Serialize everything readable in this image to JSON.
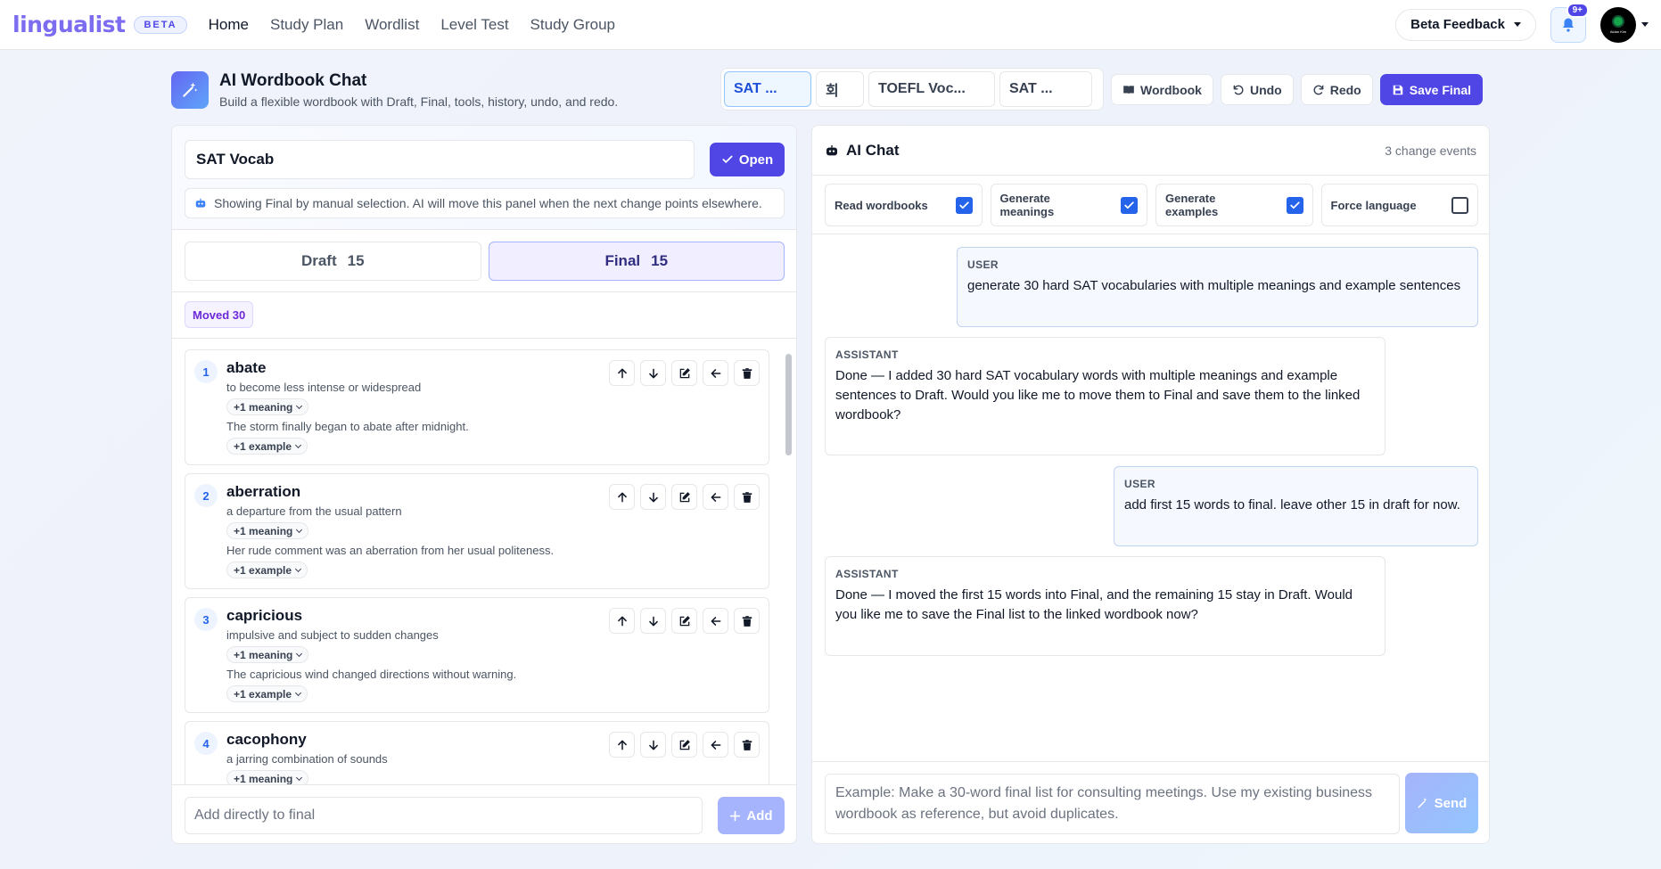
{
  "nav": {
    "logo": "lingualist",
    "beta": "BETA",
    "links": [
      "Home",
      "Study Plan",
      "Wordlist",
      "Level Test",
      "Study Group"
    ],
    "feedback": "Beta Feedback",
    "notif_count": "9+",
    "avatar_text": "Aidan Kim"
  },
  "header": {
    "title": "AI Wordbook Chat",
    "subtitle": "Build a flexible wordbook with Draft, Final, tools, history, undo, and redo."
  },
  "wordbook_tabs": [
    "SAT ...",
    "회",
    "TOEFL Voc...",
    "SAT ..."
  ],
  "toolbar": {
    "wordbook": "Wordbook",
    "undo": "Undo",
    "redo": "Redo",
    "save_final": "Save Final"
  },
  "left": {
    "wordbook_name": "SAT Vocab",
    "open": "Open",
    "info": "Showing Final by manual selection. AI will move this panel when the next change points elsewhere.",
    "draft_label": "Draft",
    "draft_count": "15",
    "final_label": "Final",
    "final_count": "15",
    "moved": "Moved 30",
    "words": [
      {
        "num": "1",
        "term": "abate",
        "def": "to become less intense or widespread",
        "meaning_chip": "+1 meaning",
        "example": "The storm finally began to abate after midnight.",
        "example_chip": "+1 example"
      },
      {
        "num": "2",
        "term": "aberration",
        "def": "a departure from the usual pattern",
        "meaning_chip": "+1 meaning",
        "example": "Her rude comment was an aberration from her usual politeness.",
        "example_chip": "+1 example"
      },
      {
        "num": "3",
        "term": "capricious",
        "def": "impulsive and subject to sudden changes",
        "meaning_chip": "+1 meaning",
        "example": "The capricious wind changed directions without warning.",
        "example_chip": "+1 example"
      },
      {
        "num": "4",
        "term": "cacophony",
        "def": "a jarring combination of sounds",
        "meaning_chip": "+1 meaning",
        "example": "",
        "example_chip": ""
      }
    ],
    "add_placeholder": "Add directly to final",
    "add": "Add"
  },
  "chat": {
    "title": "AI Chat",
    "count": "3 change events",
    "toggles": [
      {
        "label": "Read wordbooks",
        "checked": true
      },
      {
        "label": "Generate meanings",
        "checked": true
      },
      {
        "label": "Generate examples",
        "checked": true
      },
      {
        "label": "Force language",
        "checked": false
      }
    ],
    "messages": [
      {
        "role": "USER",
        "text": "generate 30 hard SAT vocabularies with multiple meanings and example sentences"
      },
      {
        "role": "ASSISTANT",
        "text": "Done — I added 30 hard SAT vocabulary words with multiple meanings and example sentences to Draft. Would you like me to move them to Final and save them to the linked wordbook?"
      },
      {
        "role": "USER",
        "text": "add first 15 words to final. leave other 15 in draft for now."
      },
      {
        "role": "ASSISTANT",
        "text": "Done — I moved the first 15 words into Final, and the remaining 15 stay in Draft. Would you like me to save the Final list to the linked wordbook now?"
      }
    ],
    "input_placeholder": "Example: Make a 30-word final list for consulting meetings. Use my existing business wordbook as reference, but avoid duplicates.",
    "send": "Send"
  },
  "colors": {
    "accent": "#4f46e5",
    "check": "#2563eb",
    "logo": "#7c6cf0"
  }
}
